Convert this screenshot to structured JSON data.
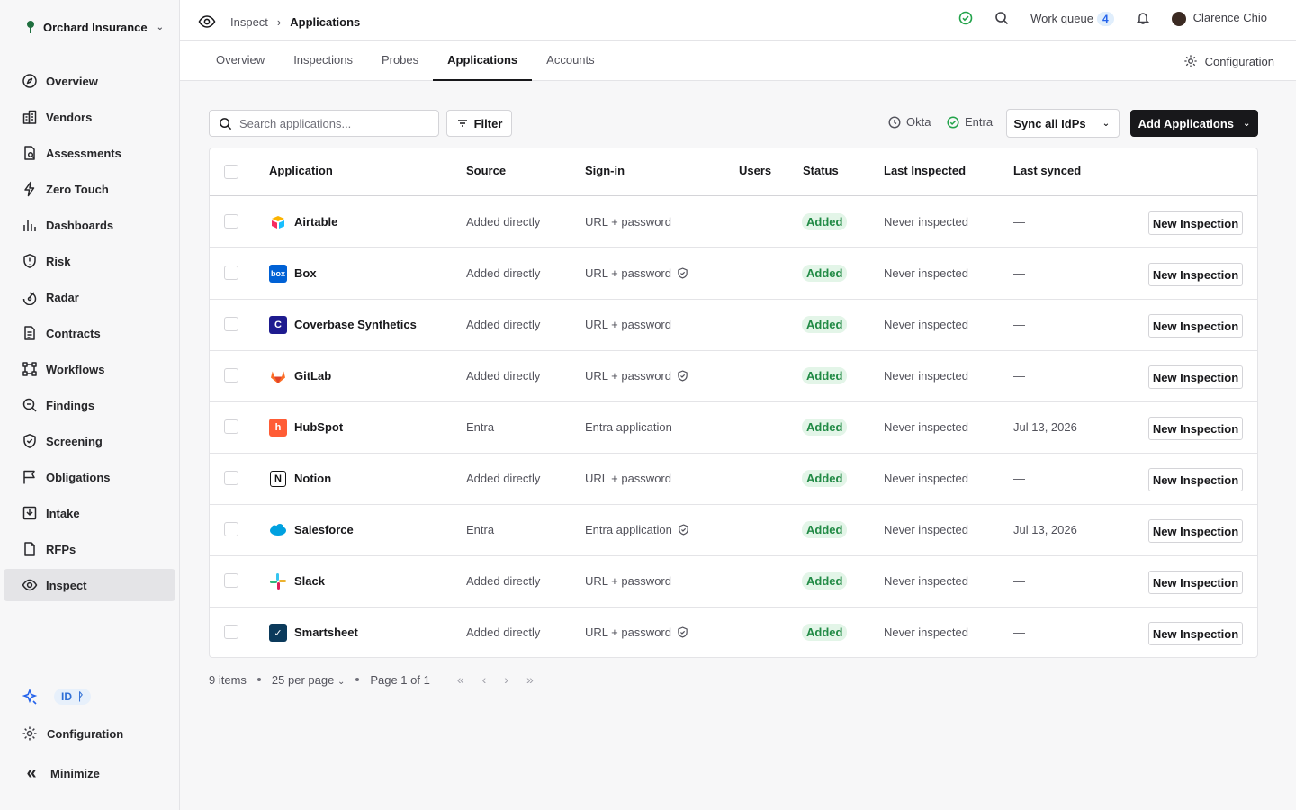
{
  "org": {
    "name": "Orchard Insurance"
  },
  "sidebar": {
    "items": [
      {
        "label": "Overview",
        "icon": "compass-icon"
      },
      {
        "label": "Vendors",
        "icon": "building-icon"
      },
      {
        "label": "Assessments",
        "icon": "document-search-icon"
      },
      {
        "label": "Zero Touch",
        "icon": "lightning-icon"
      },
      {
        "label": "Dashboards",
        "icon": "bar-chart-icon"
      },
      {
        "label": "Risk",
        "icon": "shield-alert-icon"
      },
      {
        "label": "Radar",
        "icon": "radar-icon"
      },
      {
        "label": "Contracts",
        "icon": "contract-icon"
      },
      {
        "label": "Workflows",
        "icon": "workflow-icon"
      },
      {
        "label": "Findings",
        "icon": "magnifier-icon"
      },
      {
        "label": "Screening",
        "icon": "shield-check-icon"
      },
      {
        "label": "Obligations",
        "icon": "flag-icon"
      },
      {
        "label": "Intake",
        "icon": "inbox-icon"
      },
      {
        "label": "RFPs",
        "icon": "file-icon"
      },
      {
        "label": "Inspect",
        "icon": "eye-icon",
        "active": true
      }
    ],
    "id_badge": "ID",
    "configuration": "Configuration",
    "minimize": "Minimize"
  },
  "breadcrumb": {
    "parent": "Inspect",
    "current": "Applications"
  },
  "header": {
    "work_queue_label": "Work queue",
    "work_queue_count": "4",
    "user_name": "Clarence Chio"
  },
  "tabs": [
    "Overview",
    "Inspections",
    "Probes",
    "Applications",
    "Accounts"
  ],
  "active_tab": "Applications",
  "config_link": "Configuration",
  "toolbar": {
    "search_placeholder": "Search applications...",
    "filter_label": "Filter",
    "idp_okta": "Okta",
    "idp_entra": "Entra",
    "sync_label": "Sync all IdPs",
    "add_label": "Add Applications"
  },
  "table": {
    "headers": [
      "Application",
      "Source",
      "Sign-in",
      "Users",
      "Status",
      "Last Inspected",
      "Last synced"
    ],
    "rows": [
      {
        "name": "Airtable",
        "source": "Added directly",
        "signin": "URL + password",
        "shield": false,
        "status": "Added",
        "inspected": "Never inspected",
        "synced": "—",
        "action": "New Inspection",
        "logo": "airtable"
      },
      {
        "name": "Box",
        "source": "Added directly",
        "signin": "URL + password",
        "shield": true,
        "status": "Added",
        "inspected": "Never inspected",
        "synced": "—",
        "action": "New Inspection",
        "logo": "box"
      },
      {
        "name": "Coverbase Synthetics",
        "source": "Added directly",
        "signin": "URL + password",
        "shield": false,
        "status": "Added",
        "inspected": "Never inspected",
        "synced": "—",
        "action": "New Inspection",
        "logo": "coverbase"
      },
      {
        "name": "GitLab",
        "source": "Added directly",
        "signin": "URL + password",
        "shield": true,
        "status": "Added",
        "inspected": "Never inspected",
        "synced": "—",
        "action": "New Inspection",
        "logo": "gitlab"
      },
      {
        "name": "HubSpot",
        "source": "Entra",
        "signin": "Entra application",
        "shield": false,
        "status": "Added",
        "inspected": "Never inspected",
        "synced": "Jul 13, 2026",
        "action": "New Inspection",
        "logo": "hubspot"
      },
      {
        "name": "Notion",
        "source": "Added directly",
        "signin": "URL + password",
        "shield": false,
        "status": "Added",
        "inspected": "Never inspected",
        "synced": "—",
        "action": "New Inspection",
        "logo": "notion"
      },
      {
        "name": "Salesforce",
        "source": "Entra",
        "signin": "Entra application",
        "shield": true,
        "status": "Added",
        "inspected": "Never inspected",
        "synced": "Jul 13, 2026",
        "action": "New Inspection",
        "logo": "salesforce"
      },
      {
        "name": "Slack",
        "source": "Added directly",
        "signin": "URL + password",
        "shield": false,
        "status": "Added",
        "inspected": "Never inspected",
        "synced": "—",
        "action": "New Inspection",
        "logo": "slack"
      },
      {
        "name": "Smartsheet",
        "source": "Added directly",
        "signin": "URL + password",
        "shield": true,
        "status": "Added",
        "inspected": "Never inspected",
        "synced": "—",
        "action": "New Inspection",
        "logo": "smartsheet"
      }
    ]
  },
  "pagination": {
    "items": "9 items",
    "per_page": "25 per page",
    "page": "Page 1 of 1"
  }
}
